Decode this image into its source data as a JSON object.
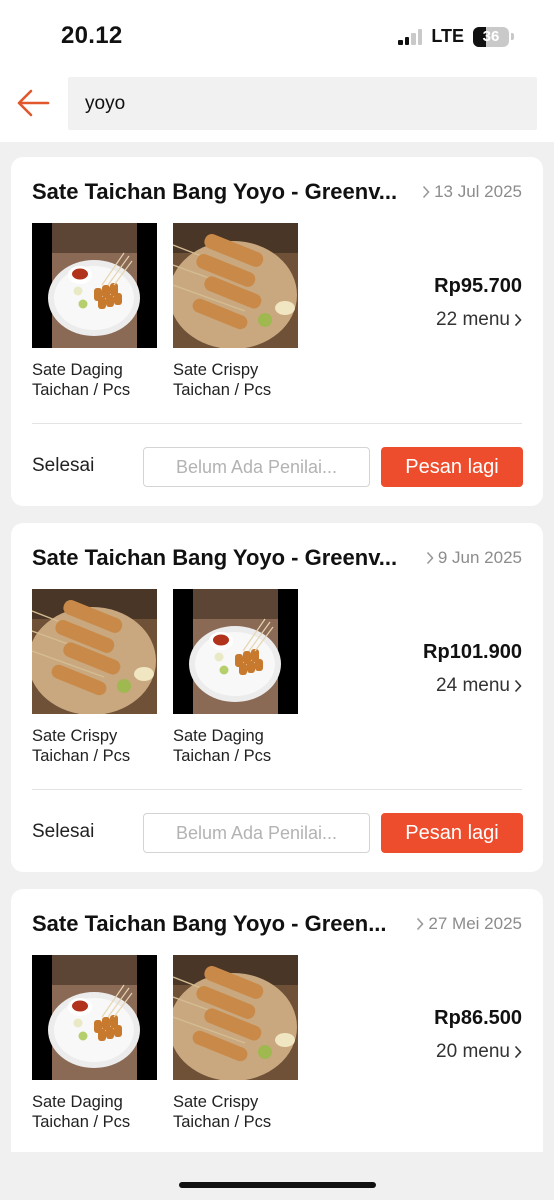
{
  "status_bar": {
    "time": "20.12",
    "network": "LTE",
    "battery": "36",
    "battery_level": 0.36
  },
  "search": {
    "query": "yoyo",
    "back_icon": "arrow-left-icon"
  },
  "colors": {
    "accent": "#ee4d2d",
    "back_arrow": "#e0582b"
  },
  "orders": [
    {
      "shop": "Sate Taichan Bang Yoyo - Greenv...",
      "date": "13 Jul 2025",
      "price": "Rp95.700",
      "menu_count": "22 menu",
      "items": [
        {
          "name": "Sate Daging Taichan / Pcs",
          "image": "plate-skewers-photo"
        },
        {
          "name": "Sate Crispy Taichan / Pcs",
          "image": "crispy-skewers-photo"
        }
      ],
      "status": "Selesai",
      "rating_label": "Belum Ada Penilai...",
      "reorder_label": "Pesan lagi"
    },
    {
      "shop": "Sate Taichan Bang Yoyo - Greenv...",
      "date": "9 Jun 2025",
      "price": "Rp101.900",
      "menu_count": "24 menu",
      "items": [
        {
          "name": "Sate Crispy Taichan / Pcs",
          "image": "crispy-skewers-photo"
        },
        {
          "name": "Sate Daging Taichan / Pcs",
          "image": "plate-skewers-photo"
        }
      ],
      "status": "Selesai",
      "rating_label": "Belum Ada Penilai...",
      "reorder_label": "Pesan lagi"
    },
    {
      "shop": "Sate Taichan Bang Yoyo - Green...",
      "date": "27 Mei 2025",
      "price": "Rp86.500",
      "menu_count": "20 menu",
      "items": [
        {
          "name": "Sate Daging Taichan / Pcs",
          "image": "plate-skewers-photo"
        },
        {
          "name": "Sate Crispy Taichan / Pcs",
          "image": "crispy-skewers-photo"
        }
      ]
    }
  ]
}
